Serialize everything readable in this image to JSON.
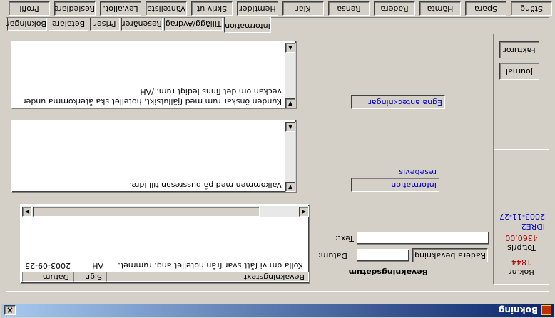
{
  "window": {
    "title": "Bokning",
    "close_glyph": "×"
  },
  "tabs": [
    "Bokningar",
    "Betalare",
    "Priser",
    "Resenärer",
    "Tillägg/Avdrag",
    "Information"
  ],
  "active_tab": "Information",
  "toolbar": [
    "Profil",
    "Reslediare",
    "Lev.allot.",
    "Väntelista",
    "Skriv ut",
    "Hemtider",
    "Klar",
    "Rensa",
    "Radera",
    "Hämta",
    "Spara",
    "Stäng"
  ],
  "notes": {
    "customer_text": "Kunden önskar rum med fjällutsikt, hotellet ska återkomma under veckan om det finns ledigt rum. /AH",
    "own_notes_label": "Egna anteckningar",
    "travel_info_text": "Välkommen med på bussresan till Idre.",
    "travel_info_label": "Information resebevis"
  },
  "reminders": {
    "columns": [
      "Datum",
      "Sign",
      "Bevakningstext"
    ],
    "rows": [
      {
        "date": "2003-09-25",
        "sign": "AH",
        "text": "Kolla om vi fått svar från hotellet ang. rummet."
      }
    ]
  },
  "reminder_form": {
    "section_title": "Bevakningsdatum",
    "date_label": "Datum:",
    "date_value": "",
    "text_label": "Text:",
    "text_value": "",
    "delete_button": "Radera bevakning"
  },
  "sidebar": {
    "invoice_button": "Fakturor",
    "journal_button": "Journal",
    "date": "2003-11-27",
    "code": "IDRE2",
    "total_label": "Tot.pris",
    "total_value": "4360.00",
    "booking_label": "Bok.nr",
    "booking_value": "1844"
  },
  "colors": {
    "blue_text": "#0000cc",
    "red_text": "#b00000",
    "title_bar": "#0a246a"
  }
}
